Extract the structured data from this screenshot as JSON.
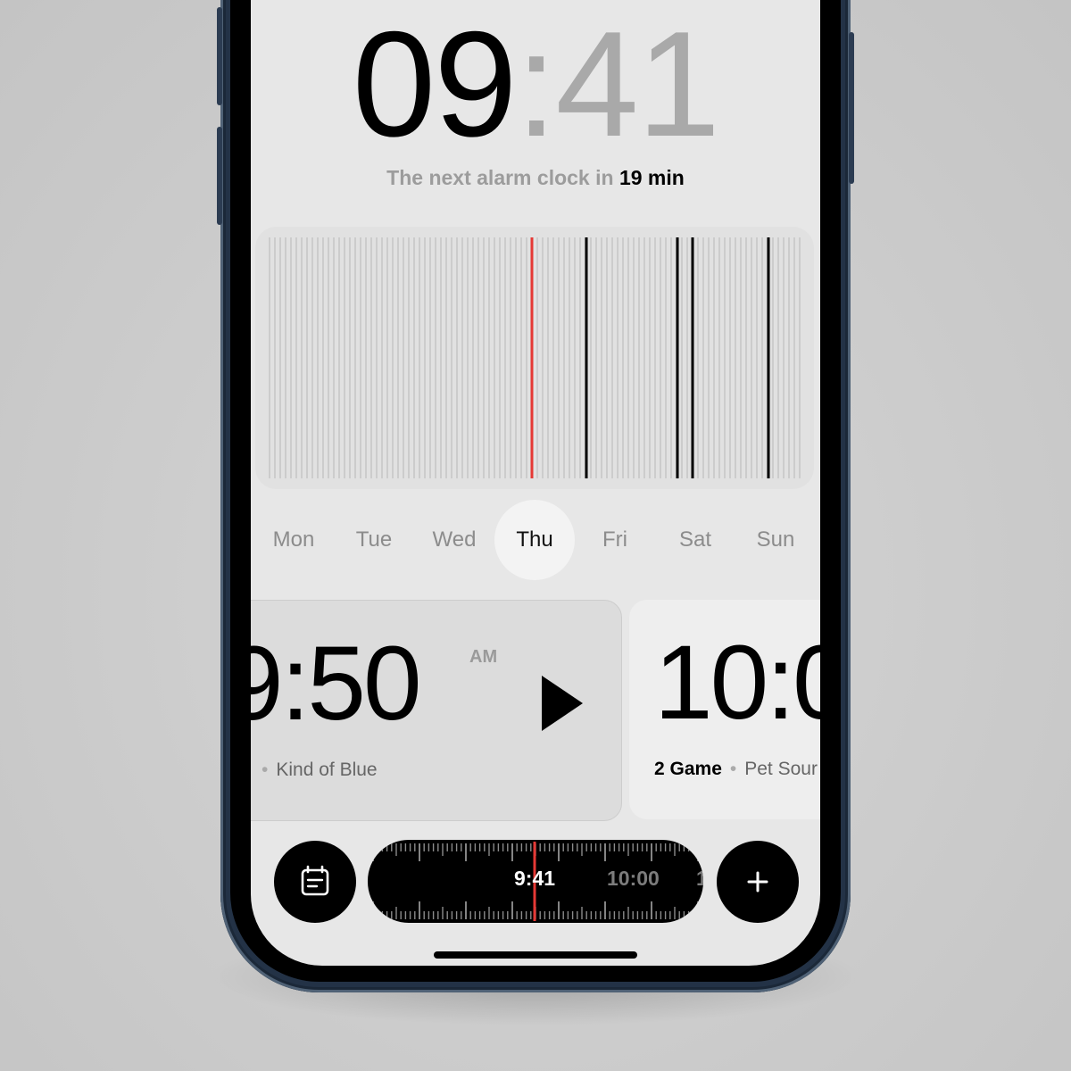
{
  "clock": {
    "hours": "09",
    "separator": ":",
    "minutes": "41"
  },
  "next_alarm": {
    "prefix": "The next alarm clock in",
    "value": "19 min"
  },
  "day_tabs": [
    {
      "label": "Mon",
      "active": false
    },
    {
      "label": "Tue",
      "active": false
    },
    {
      "label": "Wed",
      "active": false
    },
    {
      "label": "Thu",
      "active": true
    },
    {
      "label": "Fri",
      "active": false
    },
    {
      "label": "Sat",
      "active": false
    },
    {
      "label": "Sun",
      "active": false
    }
  ],
  "alarms": [
    {
      "time": "9:50",
      "meridiem": "AM",
      "sound": "Kind of Blue",
      "game": ""
    },
    {
      "time": "10:0",
      "meridiem": "",
      "game": "2 Game",
      "sound": "Pet Sour"
    }
  ],
  "timeline": {
    "current": "9:41",
    "next": "10:00",
    "after": "1"
  },
  "icons": {
    "calendar": "calendar-icon",
    "add": "plus-icon",
    "play": "play-icon"
  },
  "colors": {
    "background": "#cbcbcb",
    "screen": "#e7e7e7",
    "accent_red": "#e53935",
    "frame": "#233246"
  }
}
